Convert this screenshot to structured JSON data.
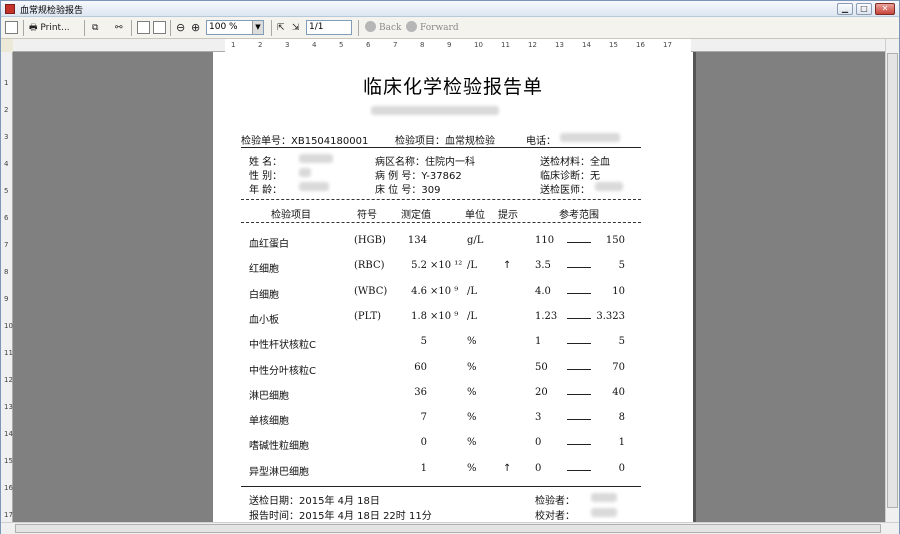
{
  "window": {
    "title": "血常规检验报告"
  },
  "toolbar": {
    "print_label": "Print...",
    "zoom_value": "100 %",
    "page_value": "1/1",
    "back_label": "Back",
    "forward_label": "Forward"
  },
  "ruler": {
    "h_ticks": [
      "1",
      "2",
      "3",
      "4",
      "5",
      "6",
      "7",
      "8",
      "9",
      "10",
      "11",
      "12",
      "13",
      "14",
      "15",
      "16",
      "17"
    ],
    "v_ticks": [
      "1",
      "2",
      "3",
      "4",
      "5",
      "6",
      "7",
      "8",
      "9",
      "10",
      "11",
      "12",
      "13",
      "14",
      "15",
      "16",
      "17"
    ]
  },
  "report": {
    "title": "临床化学检验报告单",
    "meta": {
      "sample_no_label": "检验单号：",
      "sample_no": "XB1504180001",
      "item_label": "检验项目：",
      "item": "血常规检验",
      "phone_label": "电话："
    },
    "patient": {
      "name_label": "姓    名：",
      "sex_label": "性    别：",
      "age_label": "年    龄：",
      "ward_label": "病区名称：",
      "ward": "住院内一科",
      "case_label": "病 例 号：",
      "case": "Y-37862",
      "bed_label": "床 位 号：",
      "bed": "309",
      "material_label": "送检材料：",
      "material": "全血",
      "diagnosis_label": "临床诊断：",
      "diagnosis": "无",
      "doctor_label": "送检医师："
    },
    "headers": {
      "item": "检验项目",
      "code": "符号",
      "value": "测定值",
      "unit": "单位",
      "flag": "提示",
      "range": "参考范围"
    },
    "rows": [
      {
        "item": "血红蛋白",
        "code": "(HGB)",
        "value": "134",
        "mult": "",
        "unit": "g/L",
        "flag": "",
        "low": "110",
        "high": "150"
      },
      {
        "item": "红细胞",
        "code": "(RBC)",
        "value": "5.2",
        "mult": "×10 ¹²",
        "unit": "/L",
        "flag": "↑",
        "low": "3.5",
        "high": "5"
      },
      {
        "item": "白细胞",
        "code": "(WBC)",
        "value": "4.6",
        "mult": "×10 ⁹",
        "unit": "/L",
        "flag": "",
        "low": "4.0",
        "high": "10"
      },
      {
        "item": "血小板",
        "code": "(PLT)",
        "value": "1.8",
        "mult": "×10 ⁹",
        "unit": "/L",
        "flag": "",
        "low": "1.23",
        "high": "3.323"
      },
      {
        "item": "中性杆状核粒C",
        "code": "",
        "value": "5",
        "mult": "",
        "unit": "%",
        "flag": "",
        "low": "1",
        "high": "5"
      },
      {
        "item": "中性分叶核粒C",
        "code": "",
        "value": "60",
        "mult": "",
        "unit": "%",
        "flag": "",
        "low": "50",
        "high": "70"
      },
      {
        "item": "淋巴细胞",
        "code": "",
        "value": "36",
        "mult": "",
        "unit": "%",
        "flag": "",
        "low": "20",
        "high": "40"
      },
      {
        "item": "单核细胞",
        "code": "",
        "value": "7",
        "mult": "",
        "unit": "%",
        "flag": "",
        "low": "3",
        "high": "8"
      },
      {
        "item": "嗜碱性粒细胞",
        "code": "",
        "value": "0",
        "mult": "",
        "unit": "%",
        "flag": "",
        "low": "0",
        "high": "1"
      },
      {
        "item": "异型淋巴细胞",
        "code": "",
        "value": "1",
        "mult": "",
        "unit": "%",
        "flag": "↑",
        "low": "0",
        "high": "0"
      }
    ],
    "footer": {
      "send_date": "送检日期：2015年  4月 18日",
      "report_time": "报告时间：2015年  4月 18日  22时  11分",
      "inspector_label": "检验者：",
      "checker_label": "校对者："
    }
  }
}
